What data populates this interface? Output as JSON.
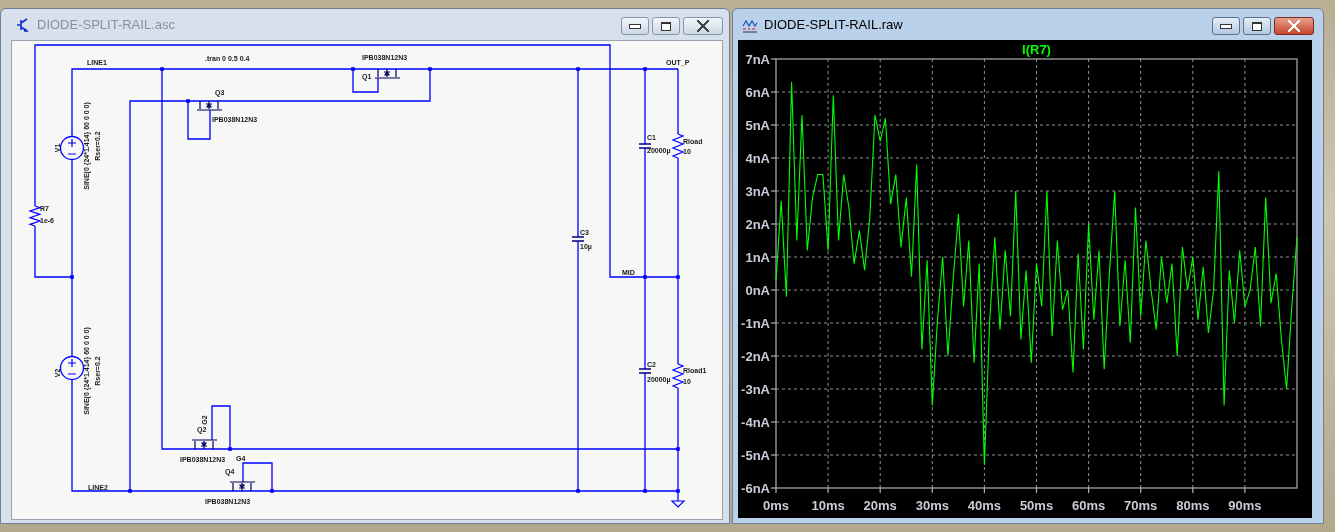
{
  "schematic_window": {
    "title": "DIODE-SPLIT-RAIL.asc",
    "active": false,
    "directive": ".tran 0 0.5 0.4",
    "net_labels": [
      "LINE1",
      "OUT_P",
      "MID",
      "G2",
      "G4",
      "LINE2"
    ],
    "components": [
      {
        "kind": "voltage_source",
        "ref": "V1",
        "value": "SINE(0 {24*1.414} 60 0 0 0)",
        "param": "Rser=0.2"
      },
      {
        "kind": "voltage_source",
        "ref": "V2",
        "value": "SINE(0 {24*1.414} 60 0 0 0)",
        "param": "Rser=0.2"
      },
      {
        "kind": "resistor",
        "ref": "R7",
        "value": "1e-6"
      },
      {
        "kind": "mosfet",
        "ref": "Q1",
        "value": "IPB038N12N3"
      },
      {
        "kind": "mosfet",
        "ref": "Q3",
        "value": "IPB038N12N3"
      },
      {
        "kind": "mosfet",
        "ref": "Q2",
        "value": "IPB038N12N3"
      },
      {
        "kind": "mosfet",
        "ref": "Q4",
        "value": "IPB038N12N3"
      },
      {
        "kind": "capacitor",
        "ref": "C3",
        "value": "10µ"
      },
      {
        "kind": "capacitor",
        "ref": "C1",
        "value": "20000µ"
      },
      {
        "kind": "capacitor",
        "ref": "C2",
        "value": "20000µ"
      },
      {
        "kind": "resistor",
        "ref": "Rload",
        "value": "10"
      },
      {
        "kind": "resistor",
        "ref": "Rload1",
        "value": "10"
      }
    ]
  },
  "waveform_window": {
    "title": "DIODE-SPLIT-RAIL.raw",
    "active": true,
    "chart_data": {
      "type": "line",
      "grid": true,
      "xlim": [
        0,
        100
      ],
      "ylim": [
        -6,
        7
      ],
      "xticks": [
        {
          "value": 0,
          "label": "0ms"
        },
        {
          "value": 10,
          "label": "10ms"
        },
        {
          "value": 20,
          "label": "20ms"
        },
        {
          "value": 30,
          "label": "30ms"
        },
        {
          "value": 40,
          "label": "40ms"
        },
        {
          "value": 50,
          "label": "50ms"
        },
        {
          "value": 60,
          "label": "60ms"
        },
        {
          "value": 70,
          "label": "70ms"
        },
        {
          "value": 80,
          "label": "80ms"
        },
        {
          "value": 90,
          "label": "90ms"
        }
      ],
      "yticks": [
        {
          "value": 7,
          "label": "7nA"
        },
        {
          "value": 6,
          "label": "6nA"
        },
        {
          "value": 5,
          "label": "5nA"
        },
        {
          "value": 4,
          "label": "4nA"
        },
        {
          "value": 3,
          "label": "3nA"
        },
        {
          "value": 2,
          "label": "2nA"
        },
        {
          "value": 1,
          "label": "1nA"
        },
        {
          "value": 0,
          "label": "0nA"
        },
        {
          "value": -1,
          "label": "-1nA"
        },
        {
          "value": -2,
          "label": "-2nA"
        },
        {
          "value": -3,
          "label": "-3nA"
        },
        {
          "value": -4,
          "label": "-4nA"
        },
        {
          "value": -5,
          "label": "-5nA"
        },
        {
          "value": -6,
          "label": "-6nA"
        }
      ],
      "x": [
        0,
        1,
        2,
        3,
        4,
        5,
        6,
        7,
        8,
        9,
        10,
        11,
        12,
        13,
        14,
        15,
        16,
        17,
        18,
        19,
        20,
        21,
        22,
        23,
        24,
        25,
        26,
        27,
        28,
        29,
        30,
        31,
        32,
        33,
        34,
        35,
        36,
        37,
        38,
        39,
        40,
        41,
        42,
        43,
        44,
        45,
        46,
        47,
        48,
        49,
        50,
        51,
        52,
        53,
        54,
        55,
        56,
        57,
        58,
        59,
        60,
        61,
        62,
        63,
        64,
        65,
        66,
        67,
        68,
        69,
        70,
        71,
        72,
        73,
        74,
        75,
        76,
        77,
        78,
        79,
        80,
        81,
        82,
        83,
        84,
        85,
        86,
        87,
        88,
        89,
        90,
        91,
        92,
        93,
        94,
        95,
        96,
        97,
        98,
        99,
        100
      ],
      "series": [
        {
          "name": "I(R7)",
          "color": "#00ff00",
          "values": [
            0.3,
            2.7,
            -0.2,
            6.3,
            1.5,
            5.3,
            1.2,
            2.8,
            3.5,
            3.5,
            1.2,
            5.9,
            1.5,
            3.5,
            2.5,
            0.8,
            1.8,
            0.6,
            2.2,
            5.3,
            4.5,
            5.2,
            2.6,
            3.5,
            1.3,
            2.8,
            0.4,
            3.8,
            -1.8,
            0.9,
            -3.5,
            -0.9,
            1.0,
            -2.0,
            0.3,
            2.3,
            -0.5,
            1.5,
            -2.2,
            0.8,
            -5.3,
            -1.0,
            1.6,
            -1.2,
            1.2,
            -0.8,
            3.0,
            -1.5,
            0.6,
            -2.2,
            0.8,
            -0.5,
            3.0,
            -1.4,
            1.5,
            -0.6,
            0.0,
            -2.5,
            1.1,
            -1.8,
            2.0,
            -0.9,
            1.2,
            -2.4,
            0.5,
            3.0,
            -1.1,
            0.9,
            -1.6,
            2.5,
            -0.8,
            1.5,
            0.0,
            -1.2,
            1.0,
            -0.4,
            0.8,
            -2.0,
            1.3,
            0.0,
            1.0,
            -0.9,
            0.7,
            -1.3,
            0.0,
            3.6,
            -3.5,
            0.6,
            -1.0,
            1.2,
            -0.5,
            0.0,
            1.3,
            -1.1,
            2.8,
            -0.4,
            0.5,
            -1.5,
            -3.0,
            -0.5,
            1.6
          ]
        }
      ]
    }
  }
}
